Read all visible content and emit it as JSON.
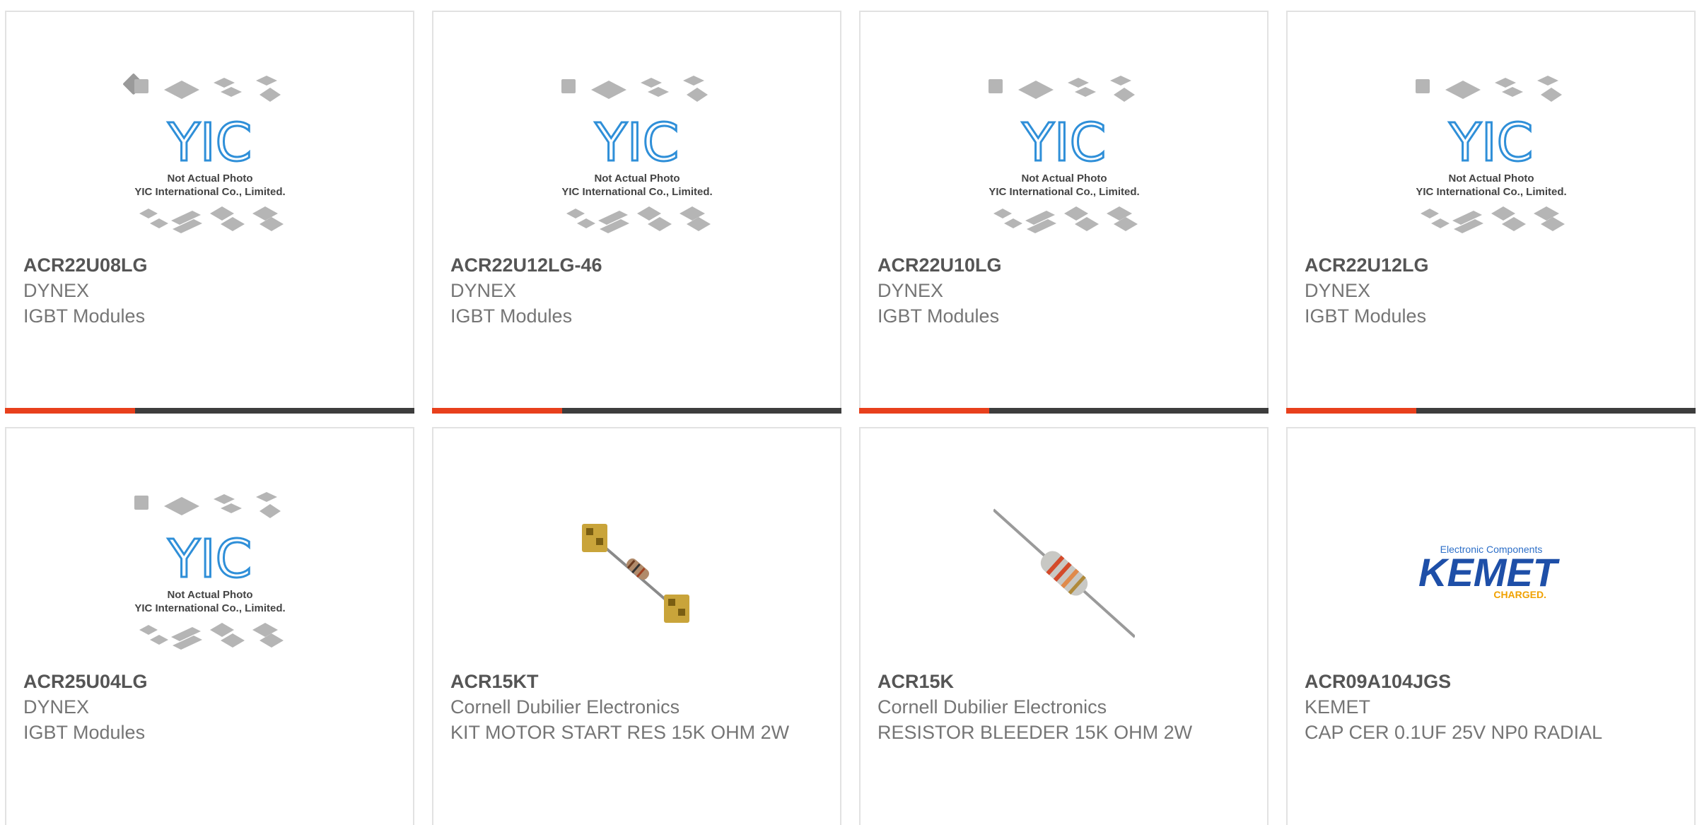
{
  "products": [
    {
      "part_number": "ACR22U08LG",
      "manufacturer": "DYNEX",
      "description": "IGBT Modules",
      "image": "yic-placeholder",
      "placeholder_line1": "Not Actual Photo",
      "placeholder_line2": "YIC International Co., Limited."
    },
    {
      "part_number": "ACR22U12LG-46",
      "manufacturer": "DYNEX",
      "description": "IGBT Modules",
      "image": "yic-placeholder",
      "placeholder_line1": "Not Actual Photo",
      "placeholder_line2": "YIC International Co., Limited."
    },
    {
      "part_number": "ACR22U10LG",
      "manufacturer": "DYNEX",
      "description": "IGBT Modules",
      "image": "yic-placeholder",
      "placeholder_line1": "Not Actual Photo",
      "placeholder_line2": "YIC International Co., Limited."
    },
    {
      "part_number": "ACR22U12LG",
      "manufacturer": "DYNEX",
      "description": "IGBT Modules",
      "image": "yic-placeholder",
      "placeholder_line1": "Not Actual Photo",
      "placeholder_line2": "YIC International Co., Limited."
    },
    {
      "part_number": "ACR25U04LG",
      "manufacturer": "DYNEX",
      "description": "IGBT Modules",
      "image": "yic-placeholder",
      "placeholder_line1": "Not Actual Photo",
      "placeholder_line2": "YIC International Co., Limited."
    },
    {
      "part_number": "ACR15KT",
      "manufacturer": "Cornell Dubilier Electronics",
      "description": "KIT MOTOR START RES 15K OHM 2W",
      "image": "resistor-kit-photo"
    },
    {
      "part_number": "ACR15K",
      "manufacturer": "Cornell Dubilier Electronics",
      "description": "RESISTOR BLEEDER 15K OHM 2W",
      "image": "resistor-photo"
    },
    {
      "part_number": "ACR09A104JGS",
      "manufacturer": "KEMET",
      "description": "CAP CER 0.1UF 25V NP0 RADIAL",
      "image": "kemet-logo",
      "logo_top": "Electronic Components",
      "logo_main": "KEMET",
      "logo_sub": "CHARGED."
    }
  ],
  "colors": {
    "accent_bar": "#e8401c",
    "dark_bar": "#3d3d3d",
    "yic_logo": "#2f8fd8",
    "kemet_blue": "#1e4fa8",
    "kemet_orange": "#f0a100"
  }
}
